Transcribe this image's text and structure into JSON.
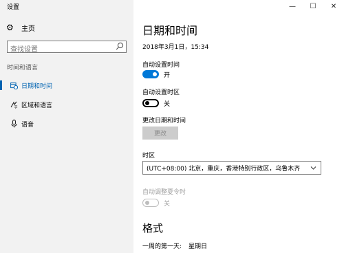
{
  "window": {
    "title": "设置",
    "minimize": "—",
    "maximize": "☐",
    "close": "✕"
  },
  "sidebar": {
    "home_label": "主页",
    "search_placeholder": "查找设置",
    "section_title": "时间和语言",
    "items": [
      {
        "label": "日期和时间",
        "icon": "date-time-icon",
        "selected": true
      },
      {
        "label": "区域和语言",
        "icon": "region-language-icon",
        "selected": false
      },
      {
        "label": "语音",
        "icon": "microphone-icon",
        "selected": false
      }
    ]
  },
  "main": {
    "title": "日期和时间",
    "current_datetime": "2018年3月1日，15:34",
    "auto_time": {
      "label": "自动设置时间",
      "state": "开",
      "on": true
    },
    "auto_timezone": {
      "label": "自动设置时区",
      "state": "关",
      "on": false
    },
    "change_datetime": {
      "label": "更改日期和时间",
      "button": "更改"
    },
    "timezone": {
      "label": "时区",
      "value": "(UTC+08:00) 北京，重庆，香港特别行政区，乌鲁木齐"
    },
    "dst": {
      "label": "自动调整夏令时",
      "state": "关",
      "enabled": false
    },
    "format": {
      "heading": "格式",
      "first_day_label": "一周的第一天:",
      "first_day_value": "星期日"
    }
  },
  "colors": {
    "accent": "#0078d7",
    "sidebar_bg": "#f2f2f2",
    "selected_indicator": "#0063b1"
  }
}
